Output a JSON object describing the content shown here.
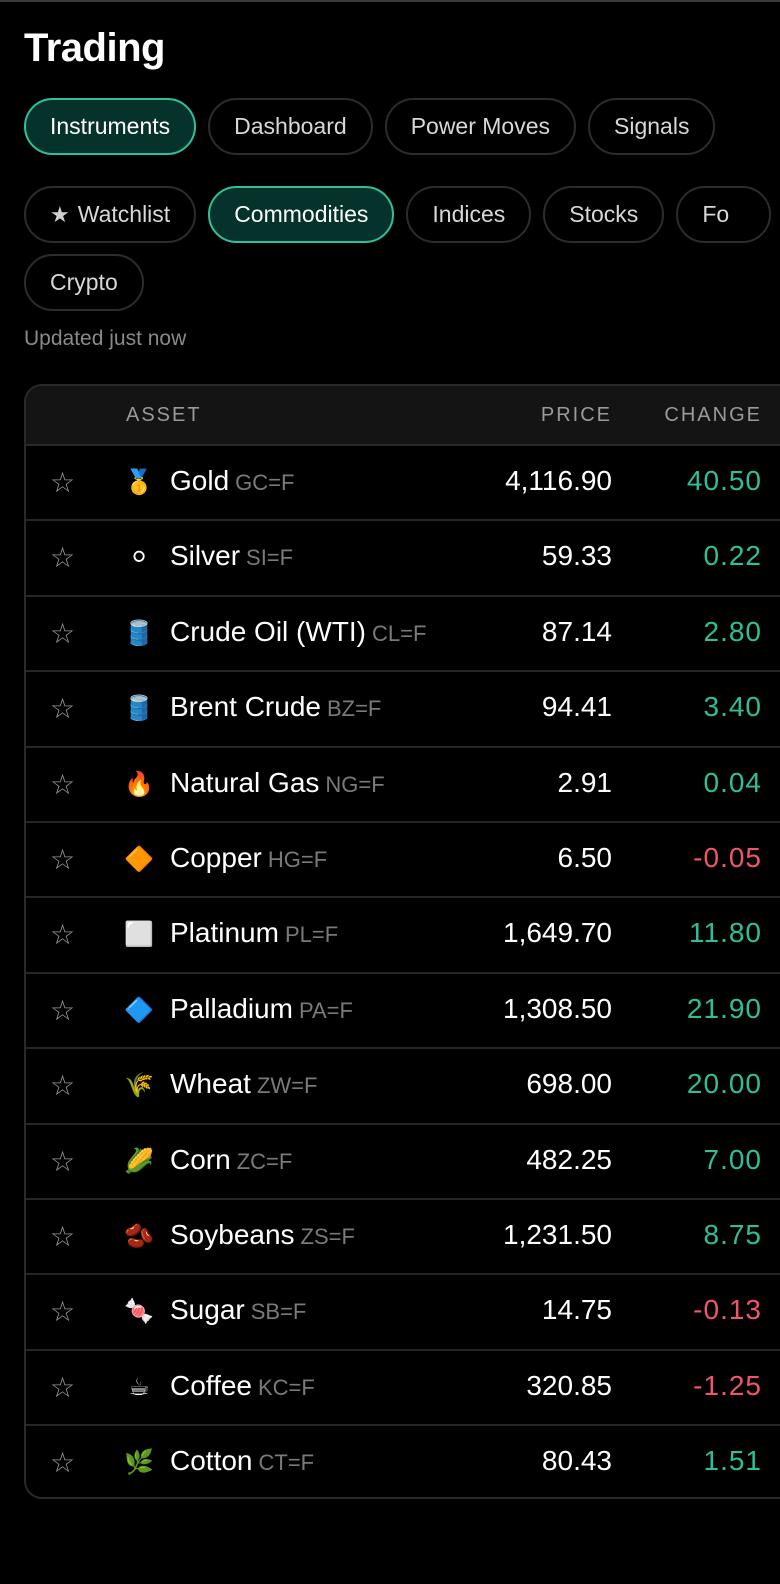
{
  "app": {
    "title": "Trading"
  },
  "main_tabs": [
    {
      "label": "Instruments",
      "active": true
    },
    {
      "label": "Dashboard",
      "active": false
    },
    {
      "label": "Power Moves",
      "active": false
    },
    {
      "label": "Signals",
      "active": false
    }
  ],
  "category_tabs": [
    {
      "label": "Watchlist",
      "icon": "star-icon",
      "active": false
    },
    {
      "label": "Commodities",
      "active": true
    },
    {
      "label": "Indices",
      "active": false
    },
    {
      "label": "Stocks",
      "active": false
    },
    {
      "label": "Fo",
      "active": false
    },
    {
      "label": "Crypto",
      "active": false
    }
  ],
  "status": {
    "updated": "Updated just now"
  },
  "table": {
    "headers": {
      "asset": "ASSET",
      "price": "PRICE",
      "change": "CHANGE"
    },
    "rows": [
      {
        "emoji": "🥇",
        "name": "Gold",
        "symbol": "GC=F",
        "price": "4,116.90",
        "change": "40.50",
        "direction": "up"
      },
      {
        "emoji": "⚪",
        "name": "Silver",
        "symbol": "SI=F",
        "price": "59.33",
        "change": "0.22",
        "direction": "up"
      },
      {
        "emoji": "🛢️",
        "name": "Crude Oil (WTI)",
        "symbol": "CL=F",
        "price": "87.14",
        "change": "2.80",
        "direction": "up"
      },
      {
        "emoji": "🛢️",
        "name": "Brent Crude",
        "symbol": "BZ=F",
        "price": "94.41",
        "change": "3.40",
        "direction": "up"
      },
      {
        "emoji": "🔥",
        "name": "Natural Gas",
        "symbol": "NG=F",
        "price": "2.91",
        "change": "0.04",
        "direction": "up"
      },
      {
        "emoji": "🔶",
        "name": "Copper",
        "symbol": "HG=F",
        "price": "6.50",
        "change": "-0.05",
        "direction": "down"
      },
      {
        "emoji": "⬜",
        "name": "Platinum",
        "symbol": "PL=F",
        "price": "1,649.70",
        "change": "11.80",
        "direction": "up"
      },
      {
        "emoji": "🔷",
        "name": "Palladium",
        "symbol": "PA=F",
        "price": "1,308.50",
        "change": "21.90",
        "direction": "up"
      },
      {
        "emoji": "🌾",
        "name": "Wheat",
        "symbol": "ZW=F",
        "price": "698.00",
        "change": "20.00",
        "direction": "up"
      },
      {
        "emoji": "🌽",
        "name": "Corn",
        "symbol": "ZC=F",
        "price": "482.25",
        "change": "7.00",
        "direction": "up"
      },
      {
        "emoji": "🫘",
        "name": "Soybeans",
        "symbol": "ZS=F",
        "price": "1,231.50",
        "change": "8.75",
        "direction": "up"
      },
      {
        "emoji": "🍬",
        "name": "Sugar",
        "symbol": "SB=F",
        "price": "14.75",
        "change": "-0.13",
        "direction": "down"
      },
      {
        "emoji": "☕",
        "name": "Coffee",
        "symbol": "KC=F",
        "price": "320.85",
        "change": "-1.25",
        "direction": "down"
      },
      {
        "emoji": "🌿",
        "name": "Cotton",
        "symbol": "CT=F",
        "price": "80.43",
        "change": "1.51",
        "direction": "up"
      }
    ]
  },
  "colors": {
    "accent": "#2fc09a",
    "active_bg": "#05332b",
    "up": "#2ebf98",
    "down": "#f0556a"
  }
}
